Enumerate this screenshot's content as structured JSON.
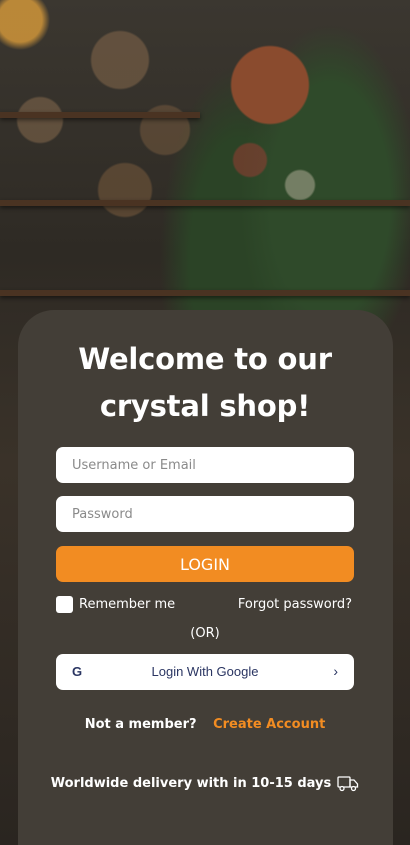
{
  "welcome": {
    "line1": "Welcome to our",
    "line2": "crystal shop!"
  },
  "form": {
    "username_placeholder": "Username or Email",
    "password_placeholder": "Password",
    "login_label": "LOGIN",
    "remember_label": "Remember me",
    "forgot_label": "Forgot password?",
    "or_label": "(OR)",
    "google_letter": "G",
    "google_label": "Login With Google",
    "google_chevron": "›"
  },
  "signup": {
    "question": "Not a member?",
    "create_label": "Create Account"
  },
  "footer": {
    "delivery_text": "Worldwide delivery  with in 10-15 days",
    "delivery_icon": "truck-icon"
  },
  "colors": {
    "accent": "#f28c22",
    "card": "#433e37",
    "google_text": "#2a3562"
  }
}
